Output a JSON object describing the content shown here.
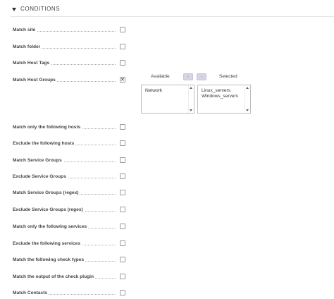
{
  "section": {
    "title": "CONDITIONS"
  },
  "conditions": [
    {
      "label": "Match site",
      "checked": false
    },
    {
      "label": "Match folder",
      "checked": false
    },
    {
      "label": "Match Host Tags",
      "checked": false
    },
    {
      "label": "Match Host Groups",
      "checked": true
    },
    {
      "label": "Match only the following hosts",
      "checked": false
    },
    {
      "label": "Exclude the following hosts",
      "checked": false
    },
    {
      "label": "Match Service Groups",
      "checked": false
    },
    {
      "label": "Exclude Service Groups",
      "checked": false
    },
    {
      "label": "Match Service Groups (regex)",
      "checked": false
    },
    {
      "label": "Exclude Service Groups (regex)",
      "checked": false
    },
    {
      "label": "Match only the following services",
      "checked": false
    },
    {
      "label": "Exclude the following services",
      "checked": false
    },
    {
      "label": "Match the following check types",
      "checked": false
    },
    {
      "label": "Match the output of the check plugin",
      "checked": false
    },
    {
      "label": "Match Contacts",
      "checked": false
    }
  ],
  "host_groups_picker": {
    "available_label": "Available",
    "selected_label": "Selected",
    "add_button_icon": "arrow-right-icon",
    "remove_button_icon": "arrow-left-icon",
    "available": [
      "Network"
    ],
    "selected": [
      "Linux_servers",
      "Windows_servers"
    ]
  }
}
